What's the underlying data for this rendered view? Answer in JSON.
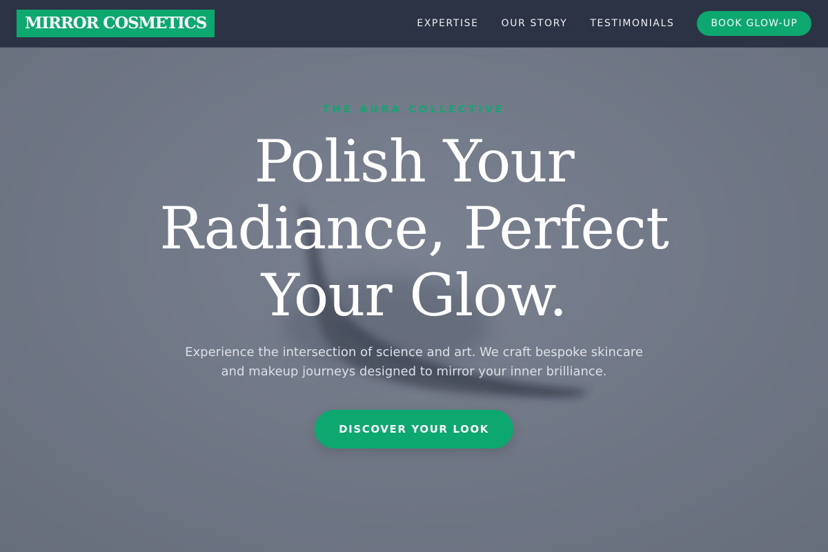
{
  "brand": {
    "logo_text": "MIRROR COSMETICS",
    "accent_color": "#0da770",
    "nav_background": "#2b3344",
    "hero_background": "#707785"
  },
  "nav": {
    "links": [
      {
        "label": "EXPERTISE"
      },
      {
        "label": "OUR STORY"
      },
      {
        "label": "TESTIMONIALS"
      }
    ],
    "cta_label": "BOOK GLOW-UP"
  },
  "hero": {
    "eyebrow": "THE AURA COLLECTIVE",
    "headline": "Polish Your Radiance, Perfect Your Glow.",
    "subtext": "Experience the intersection of science and art. We craft bespoke skincare and makeup journeys designed to mirror your inner brilliance.",
    "cta_label": "DISCOVER YOUR LOOK"
  }
}
